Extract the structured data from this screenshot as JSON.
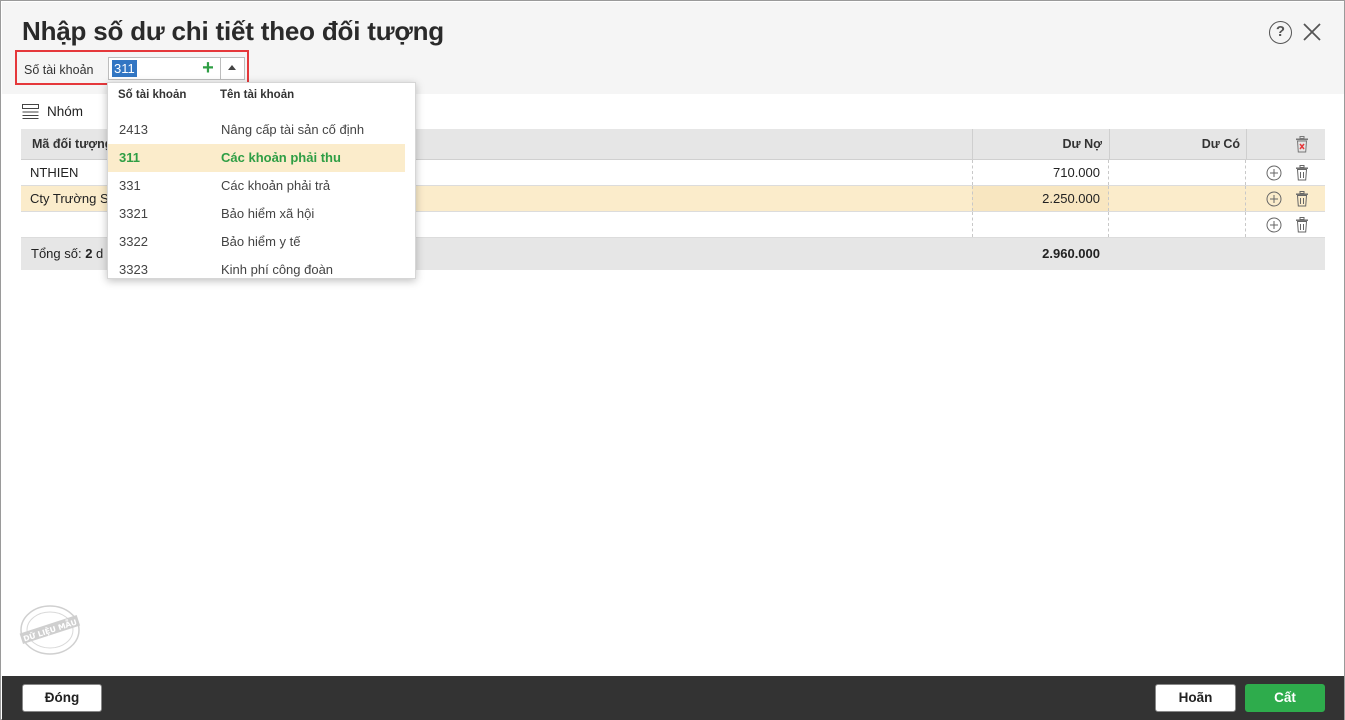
{
  "dialog": {
    "title": "Nhập số dư chi tiết theo đối tượng",
    "help_label": "?"
  },
  "account": {
    "label": "Số tài khoản",
    "value": "311",
    "add_label": "+"
  },
  "group": {
    "label": "Nhóm"
  },
  "grid": {
    "columns": {
      "code": "Mã đối tượng",
      "debit": "Dư Nợ",
      "credit": "Dư Có"
    },
    "rows": [
      {
        "code": "NTHIEN",
        "debit": "710.000",
        "credit": ""
      },
      {
        "code": "Cty Trường S",
        "debit": "2.250.000",
        "credit": ""
      },
      {
        "code": "",
        "debit": "",
        "credit": ""
      }
    ],
    "total": {
      "label_prefix": "Tổng số: ",
      "count": "2",
      "label_suffix": " d",
      "debit": "2.960.000"
    }
  },
  "dropdown": {
    "headers": {
      "number": "Số tài khoản",
      "name": "Tên tài khoản"
    },
    "items": [
      {
        "number": "2413",
        "name": "Nâng cấp tài sản cố định"
      },
      {
        "number": "311",
        "name": "Các khoản phải thu"
      },
      {
        "number": "331",
        "name": "Các khoản phải trả"
      },
      {
        "number": "3321",
        "name": "Bảo hiểm xã hội"
      },
      {
        "number": "3322",
        "name": "Bảo hiểm y tế"
      },
      {
        "number": "3323",
        "name": "Kinh phí công đoàn"
      }
    ],
    "selected": "311"
  },
  "footer": {
    "close_label": "Đóng",
    "undo_label": "Hoãn",
    "save_label": "Cất"
  },
  "stamp": {
    "text": "DỮ LIỆU MẪU"
  },
  "colors": {
    "accent_green": "#2eac4c",
    "highlight": "#fbeccb",
    "focus_red": "#e5383b",
    "footer_bg": "#333333"
  }
}
